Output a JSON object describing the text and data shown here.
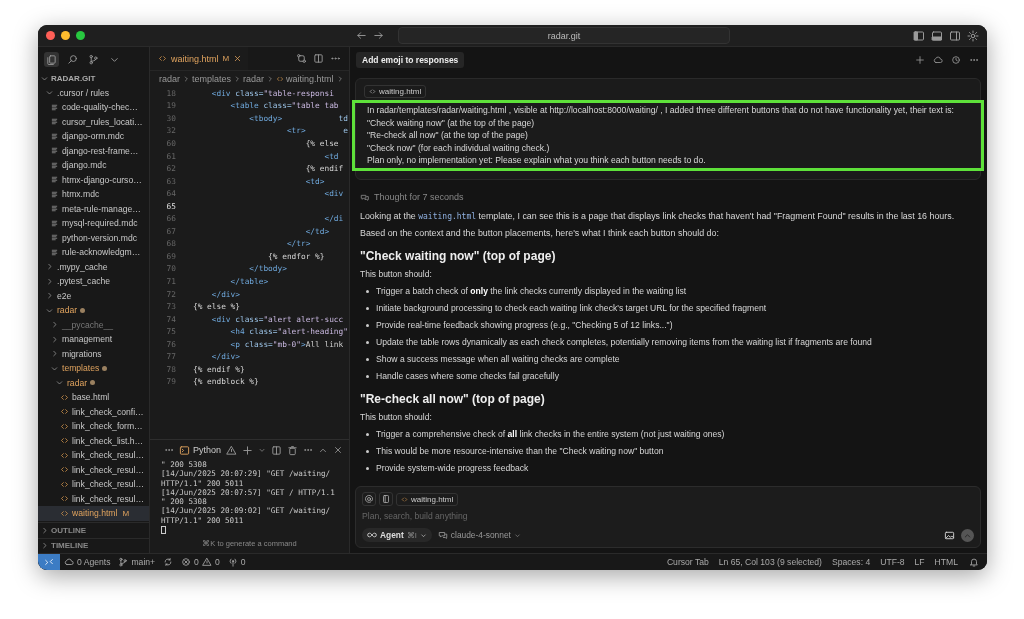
{
  "window": {
    "title": "radar.git"
  },
  "activity_bar": [
    {
      "kind": "files",
      "selected": true
    },
    {
      "kind": "search",
      "selected": false
    },
    {
      "kind": "source-control",
      "selected": false
    },
    {
      "kind": "more",
      "selected": false
    }
  ],
  "sidebar": {
    "title": "RADAR.GIT",
    "tree": [
      {
        "label": ".cursor / rules",
        "kind": "folder",
        "expanded": true,
        "modified": false,
        "selected": false,
        "children": [
          {
            "label": "code-quality-chec…",
            "kind": "rule",
            "modified": false,
            "selected": false
          },
          {
            "label": "cursor_rules_locati…",
            "kind": "rule",
            "modified": false,
            "selected": false
          },
          {
            "label": "django-orm.mdc",
            "kind": "rule",
            "modified": false,
            "selected": false
          },
          {
            "label": "django-rest-frame…",
            "kind": "rule",
            "modified": false,
            "selected": false
          },
          {
            "label": "django.mdc",
            "kind": "rule",
            "modified": false,
            "selected": false
          },
          {
            "label": "htmx-django-curso…",
            "kind": "rule",
            "modified": false,
            "selected": false
          },
          {
            "label": "htmx.mdc",
            "kind": "rule",
            "modified": false,
            "selected": false
          },
          {
            "label": "meta-rule-manage…",
            "kind": "rule",
            "modified": false,
            "selected": false
          },
          {
            "label": "mysql-required.mdc",
            "kind": "rule",
            "modified": false,
            "selected": false
          },
          {
            "label": "python-version.mdc",
            "kind": "rule",
            "modified": false,
            "selected": false
          },
          {
            "label": "rule-acknowledgm…",
            "kind": "rule",
            "modified": false,
            "selected": false
          }
        ]
      },
      {
        "label": ".mypy_cache",
        "kind": "folder",
        "expanded": false,
        "modified": false,
        "selected": false
      },
      {
        "label": ".pytest_cache",
        "kind": "folder",
        "expanded": false,
        "modified": false,
        "selected": false
      },
      {
        "label": "e2e",
        "kind": "folder",
        "expanded": false,
        "modified": false,
        "selected": false
      },
      {
        "label": "radar",
        "kind": "folder",
        "expanded": true,
        "modified": true,
        "selected": false,
        "children": [
          {
            "label": "__pycache__",
            "kind": "folder",
            "expanded": false,
            "modified": false,
            "ignored": true,
            "selected": false
          },
          {
            "label": "management",
            "kind": "folder",
            "expanded": false,
            "modified": false,
            "selected": false
          },
          {
            "label": "migrations",
            "kind": "folder",
            "expanded": false,
            "modified": false,
            "selected": false
          },
          {
            "label": "templates",
            "kind": "folder",
            "expanded": true,
            "modified": true,
            "selected": false,
            "children": [
              {
                "label": "radar",
                "kind": "folder",
                "expanded": true,
                "modified": true,
                "selected": false,
                "children": [
                  {
                    "label": "base.html",
                    "kind": "html",
                    "modified": false,
                    "selected": false
                  },
                  {
                    "label": "link_check_confi…",
                    "kind": "html",
                    "modified": false,
                    "selected": false
                  },
                  {
                    "label": "link_check_form…",
                    "kind": "html",
                    "modified": false,
                    "selected": false
                  },
                  {
                    "label": "link_check_list.h…",
                    "kind": "html",
                    "modified": false,
                    "selected": false
                  },
                  {
                    "label": "link_check_resul…",
                    "kind": "html",
                    "modified": false,
                    "selected": false
                  },
                  {
                    "label": "link_check_resul…",
                    "kind": "html",
                    "modified": false,
                    "selected": false
                  },
                  {
                    "label": "link_check_resul…",
                    "kind": "html",
                    "modified": false,
                    "selected": false
                  },
                  {
                    "label": "link_check_resul…",
                    "kind": "html",
                    "modified": false,
                    "selected": false
                  },
                  {
                    "label": "waiting.html",
                    "kind": "html",
                    "modified": true,
                    "badge": "M",
                    "selected": true
                  }
                ]
              }
            ]
          }
        ]
      }
    ],
    "sections": [
      {
        "label": "OUTLINE",
        "expanded": false
      },
      {
        "label": "TIMELINE",
        "expanded": false
      }
    ]
  },
  "editor": {
    "tabs": [
      {
        "label": "waiting.html",
        "badge": "M",
        "selected": true
      }
    ],
    "breadcrumbs": [
      "radar",
      "templates",
      "radar",
      "waiting.html"
    ],
    "lines": [
      {
        "number": "18",
        "current": false,
        "tokens": [
          {
            "kind": "tag",
            "text": "    <div"
          },
          {
            "kind": "attr",
            "text": " class="
          },
          {
            "kind": "str",
            "text": "\"table-responsi"
          }
        ]
      },
      {
        "number": "19",
        "current": false,
        "tokens": [
          {
            "kind": "tag",
            "text": "        <table"
          },
          {
            "kind": "attr",
            "text": " class="
          },
          {
            "kind": "str",
            "text": "\"table tab"
          }
        ]
      },
      {
        "number": "30",
        "current": false,
        "tokens": [
          {
            "kind": "tag",
            "text": "            <tbody>"
          },
          {
            "kind": "attr",
            "text": "            td"
          }
        ]
      },
      {
        "number": "32",
        "current": false,
        "tokens": [
          {
            "kind": "tag",
            "text": "                    <tr>"
          },
          {
            "kind": "attr",
            "text": "        e"
          }
        ]
      },
      {
        "number": "60",
        "current": false,
        "tokens": [
          {
            "kind": "tpl",
            "text": "                        {% else"
          }
        ]
      },
      {
        "number": "61",
        "current": false,
        "tokens": [
          {
            "kind": "tag",
            "text": "                            <td"
          }
        ]
      },
      {
        "number": "62",
        "current": false,
        "tokens": [
          {
            "kind": "tpl",
            "text": "                        {% endif"
          }
        ]
      },
      {
        "number": "63",
        "current": false,
        "tokens": [
          {
            "kind": "tag",
            "text": "                        <td>"
          }
        ]
      },
      {
        "number": "64",
        "current": false,
        "tokens": [
          {
            "kind": "tag",
            "text": "                            <div"
          }
        ]
      },
      {
        "number": "65",
        "current": true
      },
      {
        "number": "66",
        "current": false,
        "tokens": [
          {
            "kind": "tag",
            "text": "                            </di"
          }
        ]
      },
      {
        "number": "67",
        "current": false,
        "tokens": [
          {
            "kind": "tag",
            "text": "                        </td>"
          }
        ]
      },
      {
        "number": "68",
        "current": false,
        "tokens": [
          {
            "kind": "tag",
            "text": "                    </tr>"
          }
        ]
      },
      {
        "number": "69",
        "current": false,
        "tokens": [
          {
            "kind": "tpl",
            "text": "                {% endfor %}"
          }
        ]
      },
      {
        "number": "70",
        "current": false,
        "tokens": [
          {
            "kind": "tag",
            "text": "            </tbody>"
          }
        ]
      },
      {
        "number": "71",
        "current": false,
        "tokens": [
          {
            "kind": "tag",
            "text": "        </table>"
          }
        ]
      },
      {
        "number": "72",
        "current": false,
        "tokens": [
          {
            "kind": "tag",
            "text": "    </div>"
          }
        ]
      },
      {
        "number": "73",
        "current": false,
        "tokens": [
          {
            "kind": "tpl",
            "text": "{% else %}"
          }
        ]
      },
      {
        "number": "74",
        "current": false,
        "tokens": [
          {
            "kind": "tag",
            "text": "    <div"
          },
          {
            "kind": "attr",
            "text": " class="
          },
          {
            "kind": "str",
            "text": "\"alert alert-succ"
          }
        ]
      },
      {
        "number": "75",
        "current": false,
        "tokens": [
          {
            "kind": "tag",
            "text": "        <h4"
          },
          {
            "kind": "attr",
            "text": " class="
          },
          {
            "kind": "str",
            "text": "\"alert-heading\""
          }
        ]
      },
      {
        "number": "76",
        "current": false,
        "tokens": [
          {
            "kind": "tag",
            "text": "        <p"
          },
          {
            "kind": "attr",
            "text": " class="
          },
          {
            "kind": "str",
            "text": "\"mb-0\""
          },
          {
            "kind": "tag",
            "text": ">"
          },
          {
            "kind": "text",
            "text": "All link"
          }
        ]
      },
      {
        "number": "77",
        "current": false,
        "tokens": [
          {
            "kind": "tag",
            "text": "    </div>"
          }
        ]
      },
      {
        "number": "78",
        "current": false,
        "tokens": [
          {
            "kind": "tpl",
            "text": "{% endif %}"
          }
        ]
      },
      {
        "number": "79",
        "current": false,
        "tokens": [
          {
            "kind": "tpl",
            "text": "{% endblock %}"
          }
        ]
      }
    ]
  },
  "terminal": {
    "tab": "Python",
    "lines": [
      "\" 200 5308",
      "[14/Jun/2025 20:07:29] \"GET /waiting/",
      "HTTP/1.1\" 200 5011",
      "[14/Jun/2025 20:07:57] \"GET / HTTP/1.1",
      "\" 200 5308",
      "[14/Jun/2025 20:09:02] \"GET /waiting/",
      "HTTP/1.1\" 200 5011"
    ],
    "hint": "⌘K to generate a command"
  },
  "chat": {
    "tab": "Add emoji to responses",
    "message": {
      "attachment": "waiting.html",
      "highlighted": true,
      "lines": [
        "In radar/templates/radar/waiting.html , visible at http://localhost:8000/waiting/ , I added three different buttons that do not have functionality yet, their text is:",
        "\"Check waiting now\" (at the top of the page)",
        "\"Re-check all now\" (at the top of the page)",
        "\"Check now\" (for each individual waiting check.)",
        "Plan only, no implementation yet: Please explain what you think each button needs to do."
      ]
    },
    "thought": "Thought for 7 seconds",
    "intro": [
      {
        "parts": [
          {
            "kind": "text",
            "text": "Looking at the "
          },
          {
            "kind": "code",
            "text": "waiting.html"
          },
          {
            "kind": "text",
            "text": " template, I can see this is a page that displays link checks that haven't had \"Fragment Found\" results in the last 16 hours."
          }
        ]
      },
      {
        "parts": [
          {
            "kind": "text",
            "text": "Based on the context and the button placements, here's what I think each button should do:"
          }
        ]
      }
    ],
    "sections": [
      {
        "heading": "\"Check waiting now\" (top of page)",
        "lead": "This button should:",
        "bullets": [
          "Trigger a batch check of **only** the link checks currently displayed in the waiting list",
          "Initiate background processing to check each waiting link check's target URL for the specified fragment",
          "Provide real-time feedback showing progress (e.g., \"Checking 5 of 12 links...\")",
          "Update the table rows dynamically as each check completes, potentially removing items from the waiting list if fragments are found",
          "Show a success message when all waiting checks are complete",
          "Handle cases where some checks fail gracefully"
        ]
      },
      {
        "heading": "\"Re-check all now\" (top of page)",
        "lead": "This button should:",
        "bullets": [
          "Trigger a comprehensive check of **all** link checks in the entire system (not just waiting ones)",
          "This would be more resource-intensive than the \"Check waiting now\" button",
          "Provide system-wide progress feedback"
        ]
      }
    ],
    "composer": {
      "attachment": "waiting.html",
      "placeholder": "Plan, search, build anything",
      "mode": "Agent",
      "shortcut": "⌘I",
      "model": "claude-4-sonnet"
    }
  },
  "status_bar": {
    "agents": "0 Agents",
    "branch": "main+",
    "errors": "0",
    "warnings": "0",
    "ports": "0",
    "right": [
      "Cursor Tab",
      "Ln 65, Col 103 (9 selected)",
      "Spaces: 4",
      "UTF-8",
      "LF",
      "HTML"
    ]
  }
}
